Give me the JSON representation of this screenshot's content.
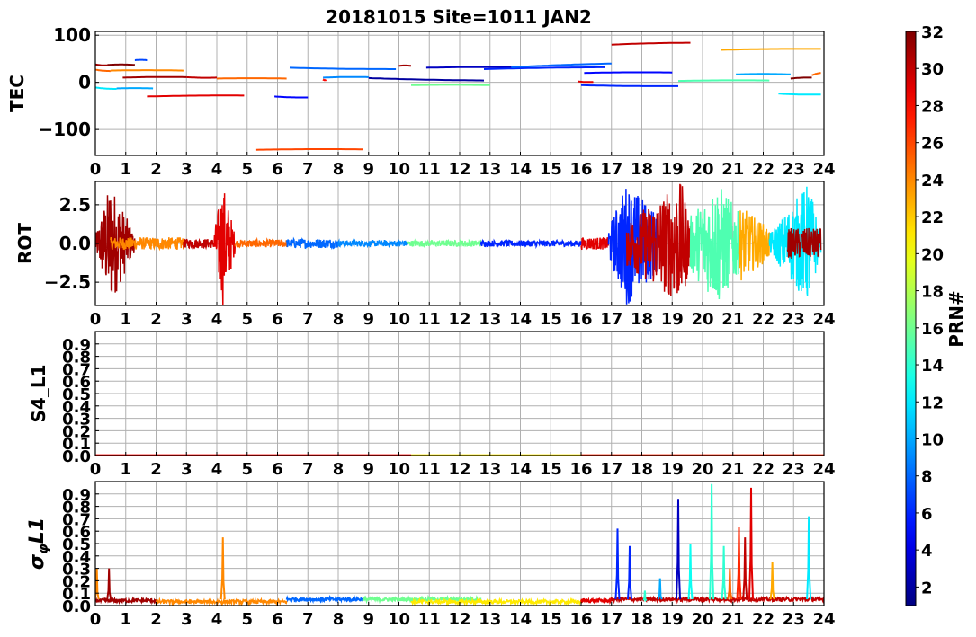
{
  "figure_title": "20181015 Site=1011 JAN2",
  "colorbar": {
    "label": "PRN#",
    "min": 1,
    "max": 32,
    "ticks": [
      "2",
      "4",
      "6",
      "8",
      "10",
      "12",
      "14",
      "16",
      "18",
      "20",
      "22",
      "24",
      "26",
      "28",
      "30",
      "32"
    ],
    "colormap": "jet"
  },
  "chart_data": [
    {
      "type": "line",
      "ylabel": "TEC",
      "xlim": [
        0,
        24
      ],
      "ylim": [
        -155,
        108
      ],
      "xticks": [
        "0",
        "1",
        "2",
        "3",
        "4",
        "5",
        "6",
        "7",
        "8",
        "9",
        "10",
        "11",
        "12",
        "13",
        "14",
        "15",
        "16",
        "17",
        "18",
        "19",
        "20",
        "21",
        "22",
        "23",
        "24"
      ],
      "yticks": [
        "100",
        "0",
        "−100"
      ],
      "ytick_values": [
        100,
        0,
        -100
      ],
      "grid": true,
      "segments": [
        {
          "prn": 31,
          "x": [
            0.0,
            0.4
          ],
          "y": [
            38,
            36
          ]
        },
        {
          "prn": 32,
          "x": [
            0.4,
            1.3
          ],
          "y": [
            37,
            37
          ]
        },
        {
          "prn": 25,
          "x": [
            0.0,
            0.5
          ],
          "y": [
            27,
            24
          ]
        },
        {
          "prn": 24,
          "x": [
            0.5,
            2.9
          ],
          "y": [
            25,
            25
          ]
        },
        {
          "prn": 12,
          "x": [
            0.0,
            0.7
          ],
          "y": [
            -11,
            -14
          ]
        },
        {
          "prn": 10,
          "x": [
            0.7,
            1.9
          ],
          "y": [
            -13,
            -13
          ]
        },
        {
          "prn": 31,
          "x": [
            0.9,
            3.0
          ],
          "y": [
            10,
            11
          ]
        },
        {
          "prn": 30,
          "x": [
            3.0,
            4.0
          ],
          "y": [
            11,
            10
          ]
        },
        {
          "prn": 7,
          "x": [
            1.3,
            1.7
          ],
          "y": [
            47,
            47
          ]
        },
        {
          "prn": 29,
          "x": [
            1.7,
            4.9
          ],
          "y": [
            -30,
            -28
          ]
        },
        {
          "prn": 25,
          "x": [
            4.0,
            6.3
          ],
          "y": [
            8,
            8
          ]
        },
        {
          "prn": 5,
          "x": [
            5.9,
            7.0
          ],
          "y": [
            -30,
            -32
          ]
        },
        {
          "prn": 26,
          "x": [
            5.3,
            8.8
          ],
          "y": [
            -143,
            -142
          ]
        },
        {
          "prn": 8,
          "x": [
            6.4,
            9.9
          ],
          "y": [
            31,
            28
          ]
        },
        {
          "prn": 9,
          "x": [
            7.5,
            9.0
          ],
          "y": [
            10,
            11
          ]
        },
        {
          "prn": 2,
          "x": [
            9.0,
            12.8
          ],
          "y": [
            9,
            4
          ]
        },
        {
          "prn": 28,
          "x": [
            7.5,
            7.6
          ],
          "y": [
            6,
            5
          ]
        },
        {
          "prn": 31,
          "x": [
            10.0,
            10.4
          ],
          "y": [
            35,
            35
          ]
        },
        {
          "prn": 16,
          "x": [
            10.4,
            13.0
          ],
          "y": [
            -6,
            -6
          ]
        },
        {
          "prn": 3,
          "x": [
            10.9,
            13.7
          ],
          "y": [
            31,
            32
          ]
        },
        {
          "prn": 6,
          "x": [
            12.8,
            16.8
          ],
          "y": [
            28,
            32
          ]
        },
        {
          "prn": 8,
          "x": [
            13.7,
            17.0
          ],
          "y": [
            32,
            40
          ]
        },
        {
          "prn": 29,
          "x": [
            15.9,
            16.4
          ],
          "y": [
            2,
            1
          ]
        },
        {
          "prn": 5,
          "x": [
            16.1,
            19.0
          ],
          "y": [
            20,
            21
          ]
        },
        {
          "prn": 6,
          "x": [
            16.0,
            19.2
          ],
          "y": [
            -6,
            -8
          ]
        },
        {
          "prn": 30,
          "x": [
            17.0,
            19.6
          ],
          "y": [
            80,
            84
          ]
        },
        {
          "prn": 15,
          "x": [
            19.2,
            22.2
          ],
          "y": [
            3,
            4
          ]
        },
        {
          "prn": 10,
          "x": [
            21.1,
            22.9
          ],
          "y": [
            17,
            17
          ]
        },
        {
          "prn": 23,
          "x": [
            20.6,
            23.9
          ],
          "y": [
            69,
            71
          ]
        },
        {
          "prn": 12,
          "x": [
            22.5,
            23.9
          ],
          "y": [
            -24,
            -26
          ]
        },
        {
          "prn": 32,
          "x": [
            22.9,
            23.6
          ],
          "y": [
            8,
            10
          ]
        },
        {
          "prn": 25,
          "x": [
            23.6,
            23.9
          ],
          "y": [
            15,
            20
          ]
        }
      ]
    },
    {
      "type": "line",
      "ylabel": "ROT",
      "xlim": [
        0,
        24
      ],
      "ylim": [
        -4,
        4
      ],
      "xticks": [
        "0",
        "1",
        "2",
        "3",
        "4",
        "5",
        "6",
        "7",
        "8",
        "9",
        "10",
        "11",
        "12",
        "13",
        "14",
        "15",
        "16",
        "17",
        "18",
        "19",
        "20",
        "21",
        "22",
        "23",
        "24"
      ],
      "yticks": [
        "2.5",
        "0.0",
        "−2.5"
      ],
      "ytick_values": [
        2.5,
        0,
        -2.5
      ],
      "grid": true,
      "segments": [
        {
          "prn": 31,
          "x": [
            0,
            0.5,
            1.3
          ],
          "amp": [
            0.5,
            4.0,
            0.5
          ]
        },
        {
          "prn": 24,
          "x": [
            0.5,
            2.9
          ],
          "amp": [
            0.4,
            0.4
          ]
        },
        {
          "prn": 30,
          "x": [
            2.9,
            3.9
          ],
          "amp": [
            0.3,
            0.3
          ]
        },
        {
          "prn": 29,
          "x": [
            3.9,
            4.2,
            4.6
          ],
          "amp": [
            0.6,
            4.0,
            0.6
          ]
        },
        {
          "prn": 25,
          "x": [
            4.6,
            6.3
          ],
          "amp": [
            0.25,
            0.25
          ]
        },
        {
          "prn": 8,
          "x": [
            6.3,
            8.0
          ],
          "amp": [
            0.3,
            0.3
          ]
        },
        {
          "prn": 9,
          "x": [
            8.0,
            10.3
          ],
          "amp": [
            0.2,
            0.2
          ]
        },
        {
          "prn": 16,
          "x": [
            10.3,
            12.7
          ],
          "amp": [
            0.2,
            0.2
          ]
        },
        {
          "prn": 6,
          "x": [
            12.7,
            16.0
          ],
          "amp": [
            0.2,
            0.2
          ]
        },
        {
          "prn": 29,
          "x": [
            16.0,
            16.9
          ],
          "amp": [
            0.4,
            0.4
          ]
        },
        {
          "prn": 6,
          "x": [
            16.9,
            17.5,
            18.5
          ],
          "amp": [
            1.0,
            4.0,
            2.0
          ]
        },
        {
          "prn": 30,
          "x": [
            17.5,
            19.3,
            19.6
          ],
          "amp": [
            1.5,
            4.0,
            1.5
          ]
        },
        {
          "prn": 15,
          "x": [
            19.6,
            20.5,
            21.2
          ],
          "amp": [
            1.8,
            4.0,
            2.0
          ]
        },
        {
          "prn": 23,
          "x": [
            21.2,
            22.2
          ],
          "amp": [
            2.5,
            1.0
          ]
        },
        {
          "prn": 12,
          "x": [
            22.2,
            23.5,
            23.9
          ],
          "amp": [
            0.6,
            4.0,
            0.6
          ]
        },
        {
          "prn": 31,
          "x": [
            22.8,
            23.9
          ],
          "amp": [
            1.0,
            1.0
          ]
        }
      ]
    },
    {
      "type": "line",
      "ylabel": "S4_L1",
      "xlim": [
        0,
        24
      ],
      "ylim": [
        0,
        1.0
      ],
      "xticks": [
        "0",
        "1",
        "2",
        "3",
        "4",
        "5",
        "6",
        "7",
        "8",
        "9",
        "10",
        "11",
        "12",
        "13",
        "14",
        "15",
        "16",
        "17",
        "18",
        "19",
        "20",
        "21",
        "22",
        "23",
        "24"
      ],
      "yticks": [
        "0.0",
        "0.1",
        "0.2",
        "0.3",
        "0.4",
        "0.5",
        "0.6",
        "0.7",
        "0.8",
        "0.9"
      ],
      "ytick_values": [
        0,
        0.1,
        0.2,
        0.3,
        0.4,
        0.5,
        0.6,
        0.7,
        0.8,
        0.9
      ],
      "grid": true,
      "segments": [
        {
          "prn": 28,
          "x": [
            0,
            10.4
          ],
          "y": [
            0.003,
            0.003
          ]
        },
        {
          "prn": 21,
          "x": [
            10.4,
            16.0
          ],
          "y": [
            0.003,
            0.003
          ]
        },
        {
          "prn": 27,
          "x": [
            16.0,
            24.0
          ],
          "y": [
            0.003,
            0.003
          ]
        }
      ]
    },
    {
      "type": "line",
      "ylabel": "σφL1",
      "ylabel_main": "σ",
      "ylabel_sub": "φ",
      "ylabel_suffix": "L1",
      "xlim": [
        0,
        24
      ],
      "ylim": [
        0,
        1.0
      ],
      "xticks": [
        "0",
        "1",
        "2",
        "3",
        "4",
        "5",
        "6",
        "7",
        "8",
        "9",
        "10",
        "11",
        "12",
        "13",
        "14",
        "15",
        "16",
        "17",
        "18",
        "19",
        "20",
        "21",
        "22",
        "23",
        "24"
      ],
      "yticks": [
        "0.0",
        "0.1",
        "0.2",
        "0.3",
        "0.4",
        "0.5",
        "0.6",
        "0.7",
        "0.8",
        "0.9"
      ],
      "ytick_values": [
        0,
        0.1,
        0.2,
        0.3,
        0.4,
        0.5,
        0.6,
        0.7,
        0.8,
        0.9
      ],
      "grid": true,
      "base_segments": [
        {
          "prn": 31,
          "x": [
            0,
            2.0
          ],
          "base": 0.04
        },
        {
          "prn": 24,
          "x": [
            2.0,
            6.3
          ],
          "base": 0.03
        },
        {
          "prn": 8,
          "x": [
            6.3,
            8.8
          ],
          "base": 0.05
        },
        {
          "prn": 16,
          "x": [
            8.8,
            12.7
          ],
          "base": 0.05
        },
        {
          "prn": 21,
          "x": [
            10.4,
            16.0
          ],
          "base": 0.03
        },
        {
          "prn": 29,
          "x": [
            16.0,
            17.0
          ],
          "base": 0.04
        },
        {
          "prn": 30,
          "x": [
            17.0,
            24.0
          ],
          "base": 0.05
        }
      ],
      "spikes": [
        {
          "prn": 24,
          "x": 0.05,
          "y": 0.3
        },
        {
          "prn": 31,
          "x": 0.45,
          "y": 0.3
        },
        {
          "prn": 24,
          "x": 4.2,
          "y": 0.55
        },
        {
          "prn": 6,
          "x": 17.2,
          "y": 0.62
        },
        {
          "prn": 6,
          "x": 17.6,
          "y": 0.48
        },
        {
          "prn": 14,
          "x": 18.1,
          "y": 0.12
        },
        {
          "prn": 10,
          "x": 18.6,
          "y": 0.22
        },
        {
          "prn": 3,
          "x": 19.2,
          "y": 0.86
        },
        {
          "prn": 13,
          "x": 19.6,
          "y": 0.5
        },
        {
          "prn": 14,
          "x": 20.3,
          "y": 0.98
        },
        {
          "prn": 14,
          "x": 20.7,
          "y": 0.48
        },
        {
          "prn": 25,
          "x": 20.9,
          "y": 0.3
        },
        {
          "prn": 27,
          "x": 21.2,
          "y": 0.63
        },
        {
          "prn": 29,
          "x": 21.6,
          "y": 0.95
        },
        {
          "prn": 23,
          "x": 22.3,
          "y": 0.35
        },
        {
          "prn": 12,
          "x": 23.5,
          "y": 0.72
        },
        {
          "prn": 30,
          "x": 21.4,
          "y": 0.55
        }
      ]
    }
  ]
}
